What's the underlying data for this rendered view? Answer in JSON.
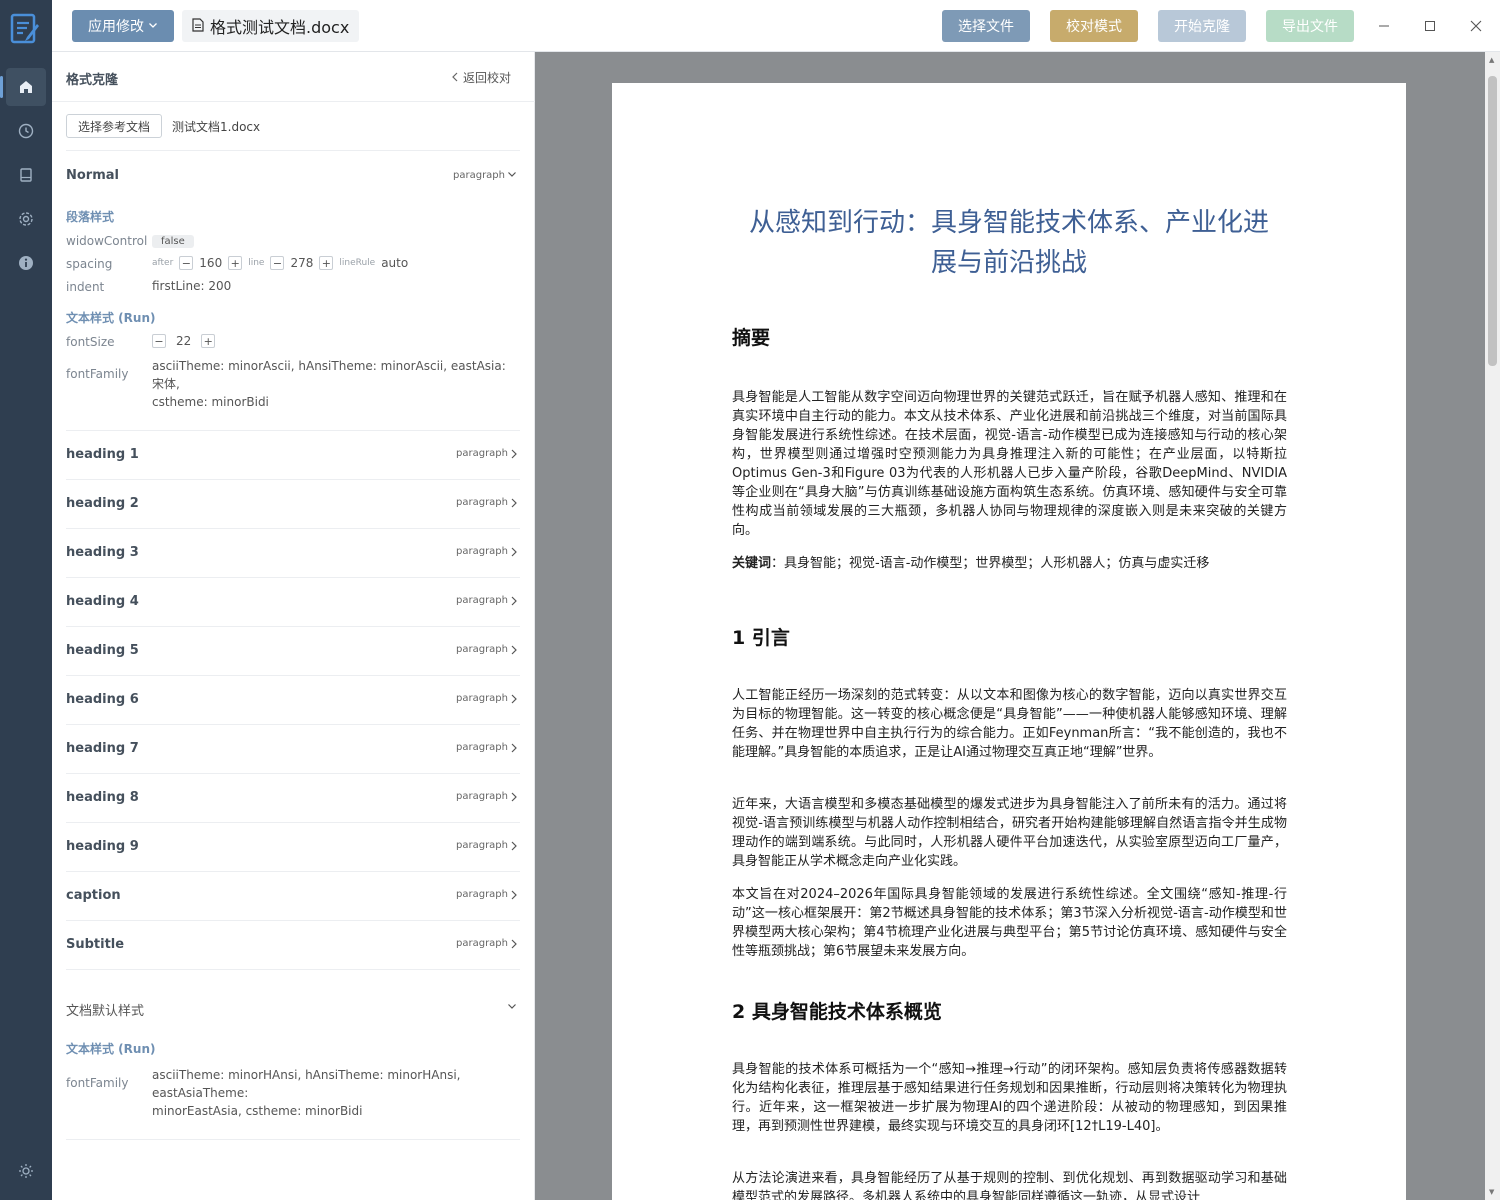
{
  "topbar": {
    "apply_label": "应用修改",
    "doc_tab": "格式测试文档.docx",
    "select_file": "选择文件",
    "proof_mode": "校对模式",
    "start_clone": "开始克隆",
    "export_file": "导出文件"
  },
  "panel": {
    "title": "格式克隆",
    "back": "返回校对",
    "ref_button": "选择参考文档",
    "ref_file": "测试文档1.docx",
    "normal": {
      "name": "Normal",
      "tag": "paragraph",
      "para_head": "段落样式",
      "widow_label": "widowControl",
      "widow_val": "false",
      "spacing_label": "spacing",
      "after_key": "after",
      "after_val": "160",
      "line_key": "line",
      "line_val": "278",
      "rule_key": "lineRule",
      "rule_val": "auto",
      "indent_label": "indent",
      "indent_val": "firstLine: 200",
      "run_head": "文本样式 (Run)",
      "size_label": "fontSize",
      "size_val": "22",
      "family_label": "fontFamily",
      "family_val1": "asciiTheme: minorAscii, hAnsiTheme: minorAscii, eastAsia: 宋体,",
      "family_val2": "cstheme: minorBidi"
    },
    "styles": [
      {
        "name": "heading 1",
        "tag": "paragraph"
      },
      {
        "name": "heading 2",
        "tag": "paragraph"
      },
      {
        "name": "heading 3",
        "tag": "paragraph"
      },
      {
        "name": "heading 4",
        "tag": "paragraph"
      },
      {
        "name": "heading 5",
        "tag": "paragraph"
      },
      {
        "name": "heading 6",
        "tag": "paragraph"
      },
      {
        "name": "heading 7",
        "tag": "paragraph"
      },
      {
        "name": "heading 8",
        "tag": "paragraph"
      },
      {
        "name": "heading 9",
        "tag": "paragraph"
      },
      {
        "name": "caption",
        "tag": "paragraph"
      },
      {
        "name": "Subtitle",
        "tag": "paragraph"
      }
    ],
    "defaults": {
      "name": "文档默认样式",
      "run_head": "文本样式 (Run)",
      "family_label": "fontFamily",
      "family_val1": "asciiTheme: minorHAnsi, hAnsiTheme: minorHAnsi, eastAsiaTheme:",
      "family_val2": "minorEastAsia, cstheme: minorBidi"
    }
  },
  "doc": {
    "title1": "从感知到行动：具身智能技术体系、产业化进",
    "title2": "展与前沿挑战",
    "abstract_head": "摘要",
    "abstract": "具身智能是人工智能从数字空间迈向物理世界的关键范式跃迁，旨在赋予机器人感知、推理和在真实环境中自主行动的能力。本文从技术体系、产业化进展和前沿挑战三个维度，对当前国际具身智能发展进行系统性综述。在技术层面，视觉-语言-动作模型已成为连接感知与行动的核心架构，世界模型则通过增强时空预测能力为具身推理注入新的可能性；在产业层面，以特斯拉Optimus Gen-3和Figure 03为代表的人形机器人已步入量产阶段，谷歌DeepMind、NVIDIA等企业则在“具身大脑”与仿真训练基础设施方面构筑生态系统。仿真环境、感知硬件与安全可靠性构成当前领域发展的三大瓶颈，多机器人协同与物理规律的深度嵌入则是未来突破的关键方向。",
    "keywords_label": "关键词",
    "keywords": "：具身智能；视觉-语言-动作模型；世界模型；人形机器人；仿真与虚实迁移",
    "h1": "1 引言",
    "p1": "人工智能正经历一场深刻的范式转变：从以文本和图像为核心的数字智能，迈向以真实世界交互为目标的物理智能。这一转变的核心概念便是“具身智能”——一种使机器人能够感知环境、理解任务、并在物理世界中自主执行行为的综合能力。正如Feynman所言：“我不能创造的，我也不能理解。”具身智能的本质追求，正是让AI通过物理交互真正地“理解”世界。",
    "p2": "近年来，大语言模型和多模态基础模型的爆发式进步为具身智能注入了前所未有的活力。通过将视觉-语言预训练模型与机器人动作控制相结合，研究者开始构建能够理解自然语言指令并生成物理动作的端到端系统。与此同时，人形机器人硬件平台加速迭代，从实验室原型迈向工厂量产，具身智能正从学术概念走向产业化实践。",
    "p3": "本文旨在对2024–2026年国际具身智能领域的发展进行系统性综述。全文围绕“感知-推理-行动”这一核心框架展开：第2节概述具身智能的技术体系；第3节深入分析视觉-语言-动作模型和世界模型两大核心架构；第4节梳理产业化进展与典型平台；第5节讨论仿真环境、感知硬件与安全性等瓶颈挑战；第6节展望未来发展方向。",
    "h2": "2 具身智能技术体系概览",
    "p4": "具身智能的技术体系可概括为一个“感知→推理→行动”的闭环架构。感知层负责将传感器数据转化为结构化表征，推理层基于感知结果进行任务规划和因果推断，行动层则将决策转化为物理执行。近年来，这一框架被进一步扩展为物理AI的四个递进阶段：从被动的物理感知，到因果推理，再到预测性世界建模，最终实现与环境交互的具身闭环[12†L19-L40]。",
    "p5": "从方法论演进来看，具身智能经历了从基于规则的控制、到优化规划、再到数据驱动学习和基础模型范式的发展路径。多机器人系统中的具身智能同样遵循这一轨迹，从显式设计"
  }
}
